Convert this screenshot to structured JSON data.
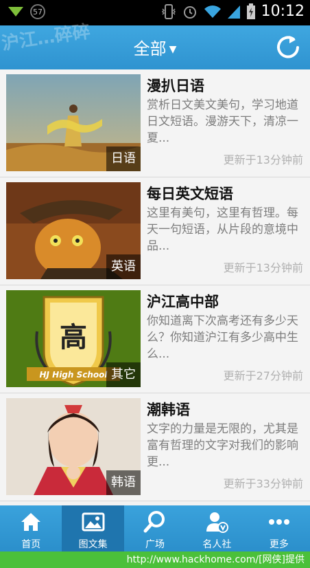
{
  "status_bar": {
    "notification_count": "57",
    "time": "10:12"
  },
  "header": {
    "logo_text": "沪江…碎碎",
    "title": "全部",
    "dropdown_arrow": "▼"
  },
  "items": [
    {
      "title": "漫扒日语",
      "description": "赏析日文美文美句，学习地道日文短语。漫游天下，清凉一夏...",
      "tag": "日语",
      "updated": "更新于13分钟前"
    },
    {
      "title": "每日英文短语",
      "description": "这里有美句，这里有哲理。每天一句短语，从片段的意境中品...",
      "tag": "英语",
      "updated": "更新于13分钟前"
    },
    {
      "title": "沪江高中部",
      "description": "你知道离下次高考还有多少天么？你知道沪江有多少高中生么...",
      "tag": "其它",
      "updated": "更新于27分钟前",
      "badge_char": "高",
      "badge_text": "HJ High School"
    },
    {
      "title": "潮韩语",
      "description": "文字的力量是无限的，尤其是富有哲理的文字对我们的影响更...",
      "tag": "韩语",
      "updated": "更新于33分钟前"
    }
  ],
  "nav": [
    {
      "label": "首页",
      "icon": "home-icon"
    },
    {
      "label": "图文集",
      "icon": "image-icon",
      "active": true
    },
    {
      "label": "广场",
      "icon": "search-icon"
    },
    {
      "label": "名人社",
      "icon": "celebrity-icon"
    },
    {
      "label": "更多",
      "icon": "more-icon"
    }
  ],
  "footer": {
    "watermark": "http://www.hackhome.com/[网侠]提供"
  }
}
